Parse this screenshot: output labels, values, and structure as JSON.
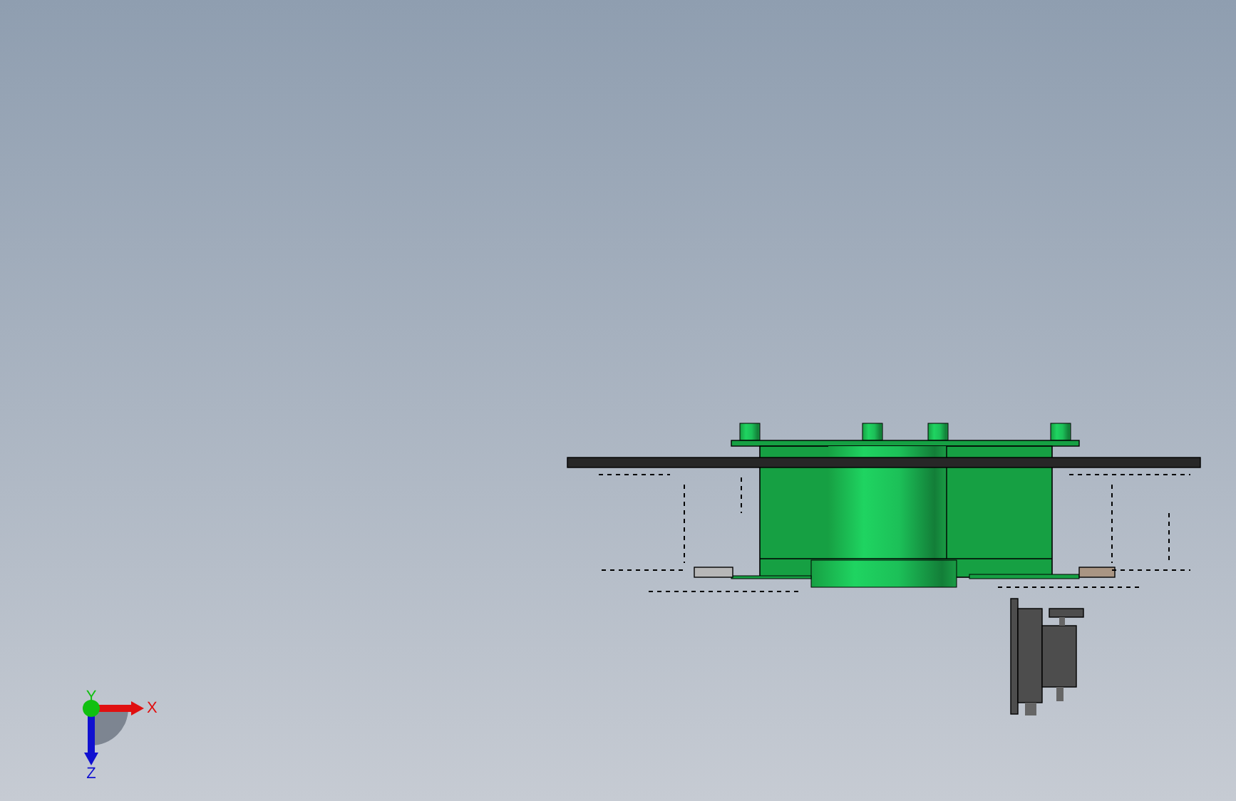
{
  "viewport": {
    "triad": {
      "axes": [
        {
          "kind": "x",
          "label": "X",
          "color": "#e01010"
        },
        {
          "kind": "y",
          "label": "Y",
          "color": "#10c010"
        },
        {
          "kind": "z",
          "label": "Z",
          "color": "#1010d0"
        }
      ]
    }
  }
}
